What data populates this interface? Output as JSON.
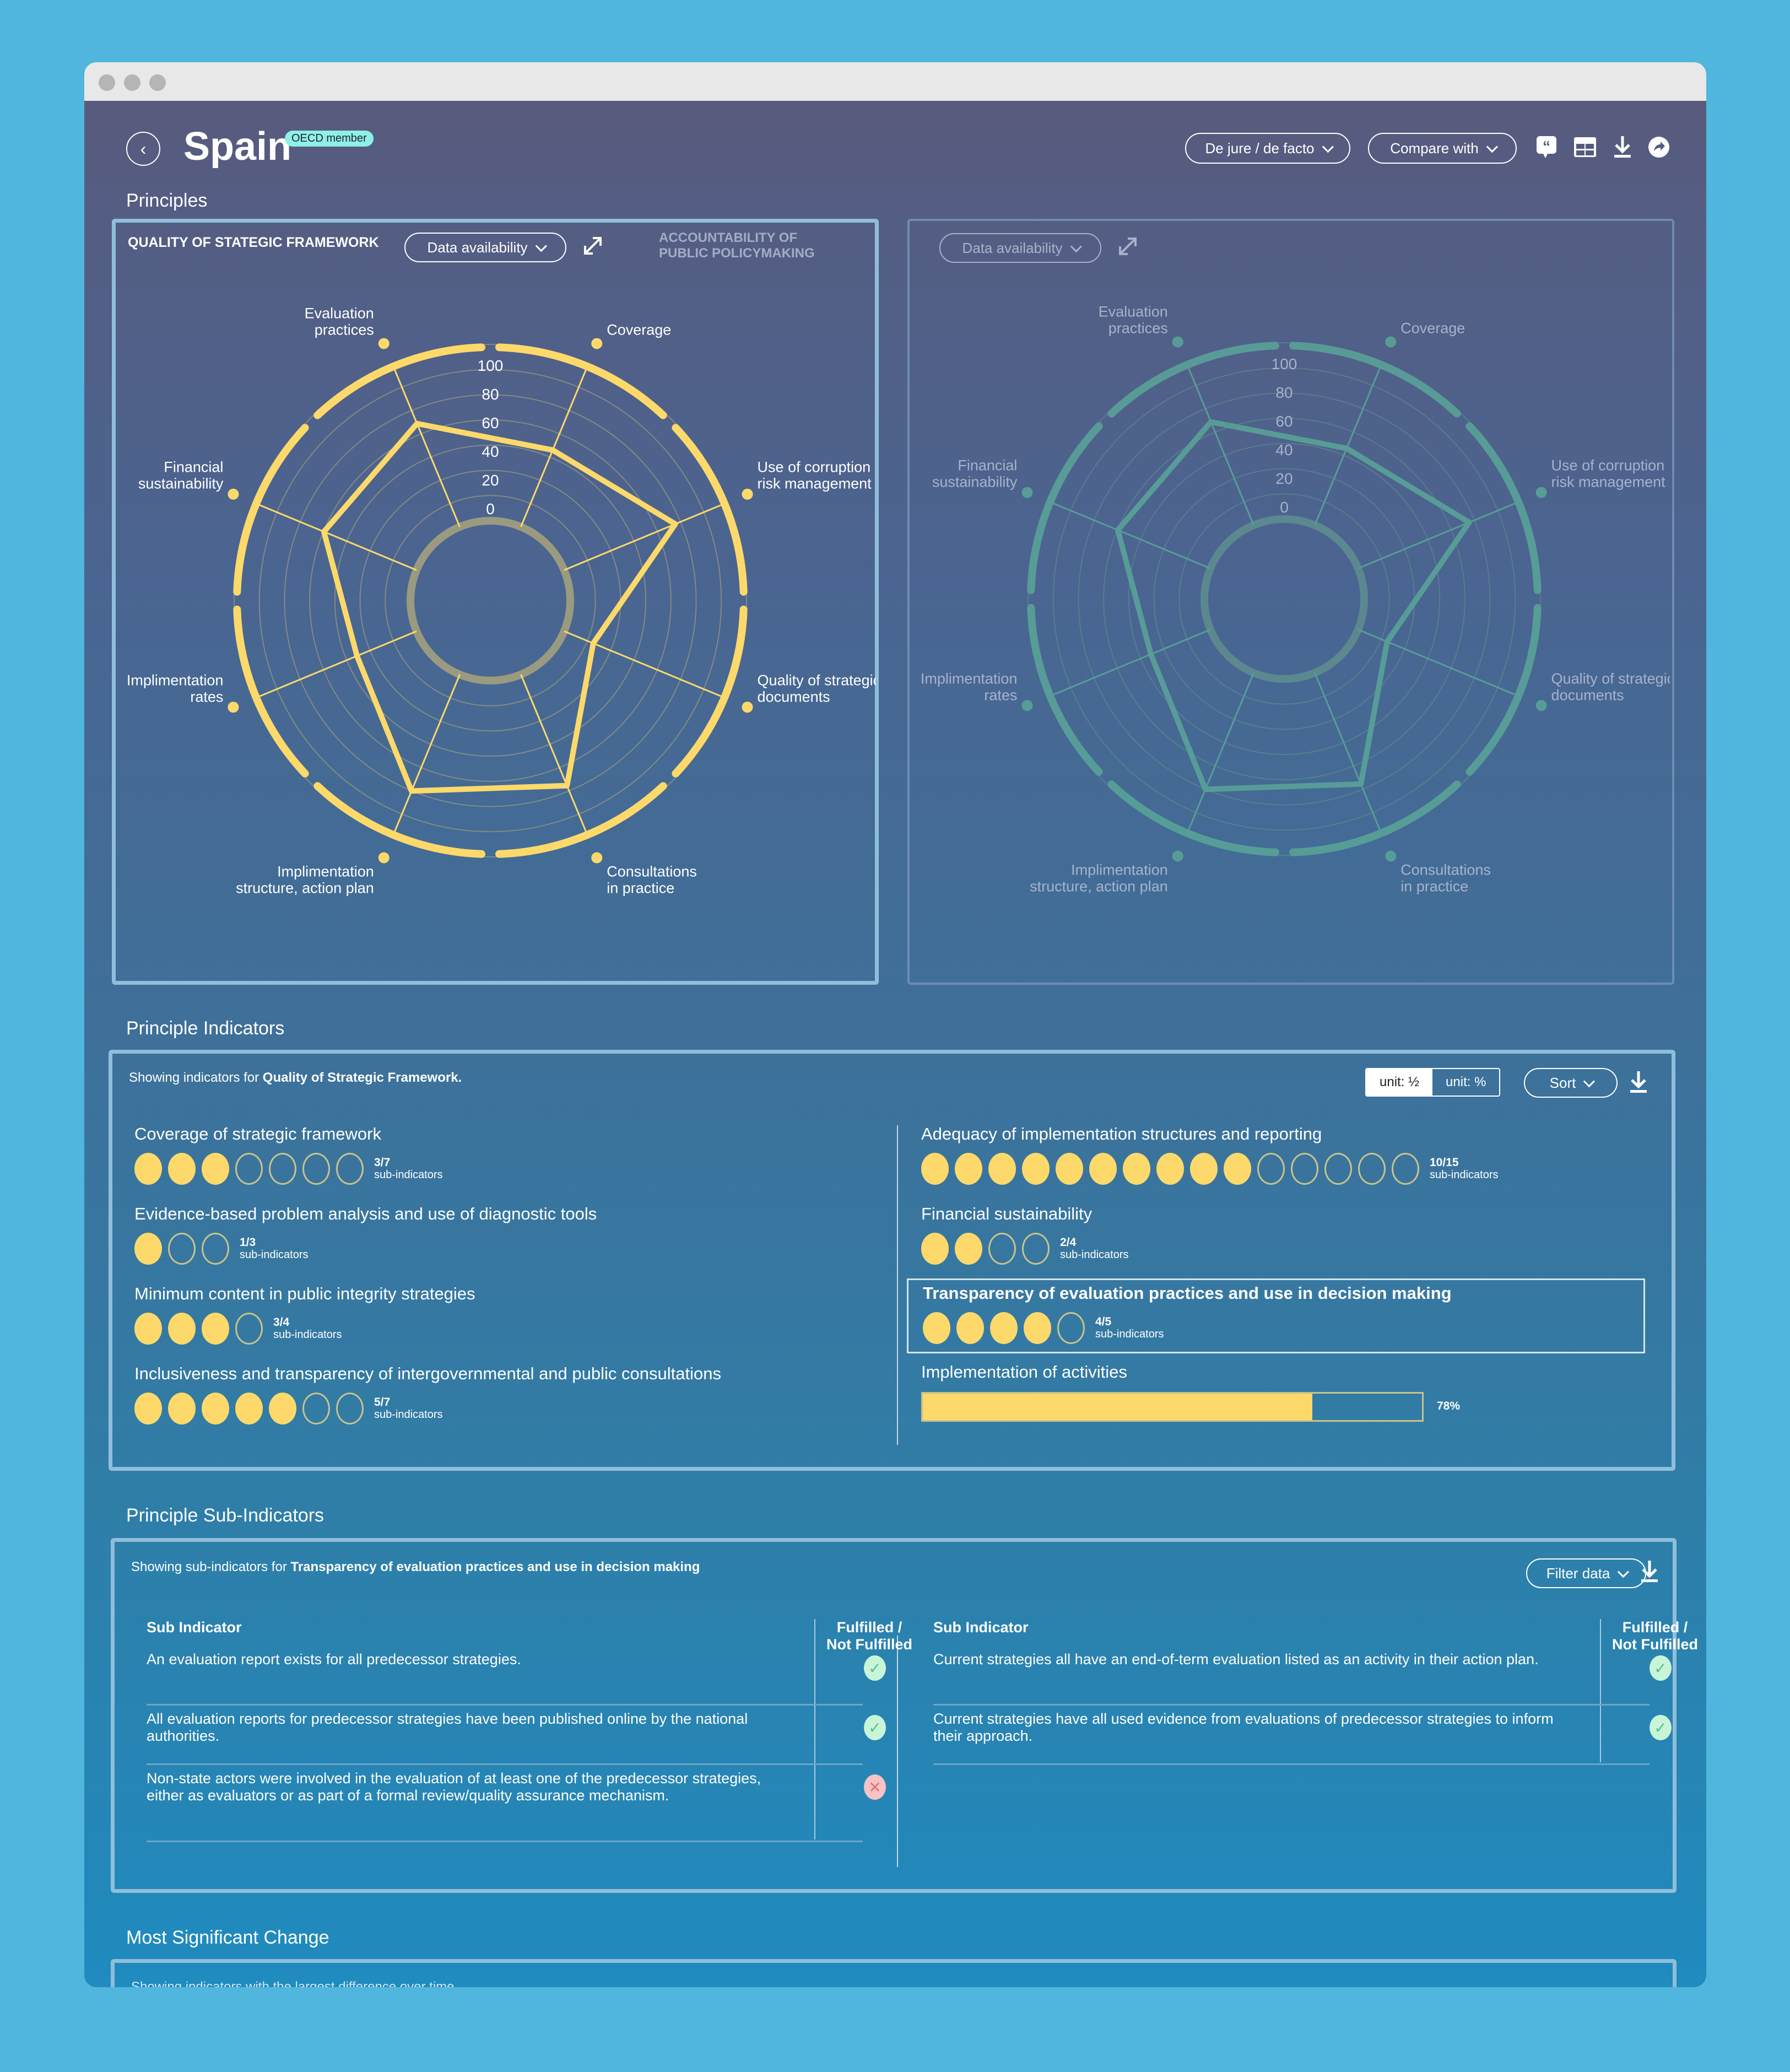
{
  "window": {
    "controls": [
      "close",
      "minimize",
      "maximize"
    ]
  },
  "header": {
    "back_icon": "chevron-left-icon",
    "title": "Spain",
    "badge": "OECD member",
    "mode_select": "De jure / de facto",
    "compare_select": "Compare with",
    "icons": [
      "quote-icon",
      "table-icon",
      "download-icon",
      "share-icon"
    ]
  },
  "principles": {
    "title": "Principles",
    "left_panel": {
      "title": "QUALITY OF STATEGIC FRAMEWORK",
      "select": "Data availability",
      "secondary_title_line1": "ACCOUNTABILITY OF",
      "secondary_title_line2": "PUBLIC POLICYMAKING"
    },
    "right_panel": {
      "select": "Data availability"
    }
  },
  "chart_data": [
    {
      "type": "radar",
      "title": "Quality of Stategic Framework",
      "color": "#fcd96a",
      "axes": [
        "Coverage",
        "Use of corruption risk management",
        "Quality of strategic documents",
        "Consultations in practice",
        "Implimentation structure, action plan",
        "Implimentation rates",
        "Financial sustainability",
        "Evaluation practices"
      ],
      "axis_labels": [
        [
          "Coverage"
        ],
        [
          "Use of corruption",
          "risk management"
        ],
        [
          "Quality of strategic",
          "documents"
        ],
        [
          "Consultations",
          "in practice"
        ],
        [
          "Implimentation",
          "structure, action plan"
        ],
        [
          "Implimentation",
          "rates"
        ],
        [
          "Financial",
          "sustainability"
        ],
        [
          "Evaluation",
          "practices"
        ]
      ],
      "values": [
        58,
        84,
        22,
        84,
        88,
        45,
        70,
        78
      ],
      "ticks": [
        "0",
        "20",
        "40",
        "60",
        "80",
        "100"
      ],
      "range": [
        0,
        100
      ]
    },
    {
      "type": "radar",
      "title": "Accountability of Public Policymaking",
      "color": "#5aa699",
      "axes": [
        "Coverage",
        "Use of corruption risk management",
        "Quality of strategic documents",
        "Consultations in practice",
        "Implimentation structure, action plan",
        "Implimentation rates",
        "Financial sustainability",
        "Evaluation practices"
      ],
      "axis_labels": [
        [
          "Coverage"
        ],
        [
          "Use of corruption",
          "risk management"
        ],
        [
          "Quality of strategic",
          "documents"
        ],
        [
          "Consultations",
          "in practice"
        ],
        [
          "Implimentation",
          "structure, action plan"
        ],
        [
          "Implimentation",
          "rates"
        ],
        [
          "Financial",
          "sustainability"
        ],
        [
          "Evaluation",
          "practices"
        ]
      ],
      "values": [
        58,
        84,
        22,
        84,
        88,
        45,
        70,
        78
      ],
      "ticks": [
        "0",
        "20",
        "40",
        "60",
        "80",
        "100"
      ],
      "range": [
        0,
        100
      ]
    }
  ],
  "indicators": {
    "title": "Principle Indicators",
    "showing_prefix": "Showing indicators for ",
    "showing_bold": "Quality of Strategic Framework.",
    "unit_half": "unit: ½",
    "unit_pct": "unit: %",
    "sort": "Sort",
    "sub_label": "sub-indicators",
    "left": [
      {
        "name": "Coverage of strategic framework",
        "filled": 3,
        "total": 7,
        "count": "3/7"
      },
      {
        "name": "Evidence-based problem analysis and use of diagnostic tools",
        "filled": 1,
        "total": 3,
        "count": "1/3"
      },
      {
        "name": "Minimum content in public integrity strategies",
        "filled": 3,
        "total": 4,
        "count": "3/4"
      },
      {
        "name": "Inclusiveness and transparency of intergovernmental and public consultations",
        "filled": 5,
        "total": 7,
        "count": "5/7"
      }
    ],
    "right": [
      {
        "name": "Adequacy of implementation structures and reporting",
        "filled": 10,
        "total": 15,
        "count": "10/15"
      },
      {
        "name": "Financial sustainability",
        "filled": 2,
        "total": 4,
        "count": "2/4"
      },
      {
        "name": "Transparency of evaluation practices and use in decision making",
        "filled": 4,
        "total": 5,
        "count": "4/5",
        "selected": true
      }
    ],
    "progress": {
      "name": "Implementation of activities",
      "value": 78,
      "label": "78%"
    }
  },
  "sub_indicators": {
    "title": "Principle Sub-Indicators",
    "showing_prefix": "Showing sub-indicators for ",
    "showing_bold": "Transparency of evaluation practices and use in decision making",
    "filter": "Filter data",
    "col_sub": "Sub Indicator",
    "col_status_1": "Fulfilled /",
    "col_status_2": "Not Fulfilled",
    "left_rows": [
      {
        "text": "An evaluation report exists for all predecessor strategies.",
        "fulfilled": true
      },
      {
        "text": "All evaluation reports for predecessor strategies have been published online by the national authorities.",
        "fulfilled": true
      },
      {
        "text": "Non-state actors were involved in the evaluation of at least one of the predecessor strategies, either as evaluators or as part of a formal review/quality assurance mechanism.",
        "fulfilled": false
      }
    ],
    "right_rows": [
      {
        "text": "Current strategies all have an end-of-term evaluation listed as an activity in their action plan.",
        "fulfilled": true
      },
      {
        "text": "Current strategies have all used evidence from evaluations of predecessor strategies to inform their approach.",
        "fulfilled": true
      }
    ]
  },
  "most_significant": {
    "title": "Most Significant Change",
    "showing": "Showing indicators with the largest difference over time"
  }
}
